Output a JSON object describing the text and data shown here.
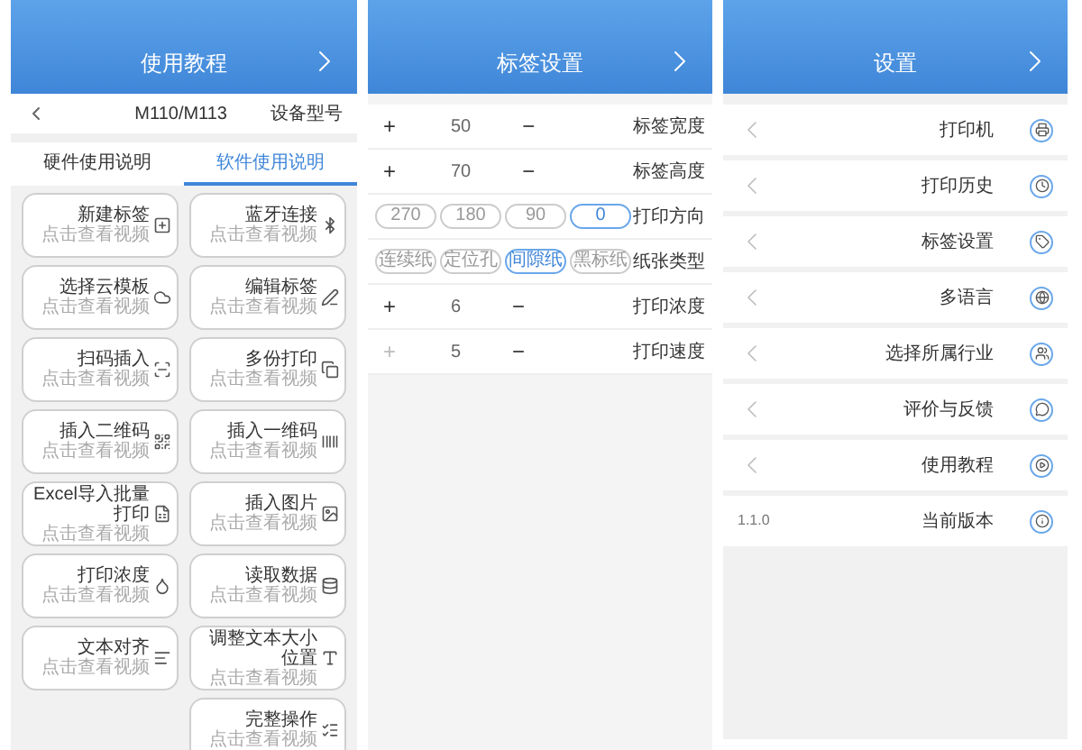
{
  "tutorial": {
    "title": "使用教程",
    "device_label": "设备型号",
    "device_value": "M110/M113",
    "tabs": [
      {
        "label": "硬件使用说明",
        "selected": false
      },
      {
        "label": "软件使用说明",
        "selected": true
      }
    ],
    "cards": [
      {
        "title": "新建标签",
        "subtitle": "点击查看视频"
      },
      {
        "title": "蓝牙连接",
        "subtitle": "点击查看视频"
      },
      {
        "title": "选择云模板",
        "subtitle": "点击查看视频"
      },
      {
        "title": "编辑标签",
        "subtitle": "点击查看视频"
      },
      {
        "title": "扫码插入",
        "subtitle": "点击查看视频"
      },
      {
        "title": "多份打印",
        "subtitle": "点击查看视频"
      },
      {
        "title": "插入二维码",
        "subtitle": "点击查看视频"
      },
      {
        "title": "插入一维码",
        "subtitle": "点击查看视频"
      },
      {
        "title": "Excel导入批量打印",
        "subtitle": "点击查看视频"
      },
      {
        "title": "插入图片",
        "subtitle": "点击查看视频"
      },
      {
        "title": "打印浓度",
        "subtitle": "点击查看视频"
      },
      {
        "title": "读取数据",
        "subtitle": "点击查看视频"
      },
      {
        "title": "文本对齐",
        "subtitle": "点击查看视频"
      },
      {
        "title": "调整文本大小位置",
        "subtitle": "点击查看视频"
      },
      {
        "title": "完整操作",
        "subtitle": "点击查看视频"
      }
    ]
  },
  "label_settings": {
    "title": "标签设置",
    "rows": [
      {
        "kind": "stepper",
        "label": "标签宽度",
        "plus": "+",
        "minus": "−",
        "value": "50",
        "plus_disabled": false
      },
      {
        "kind": "stepper",
        "label": "标签高度",
        "plus": "+",
        "minus": "−",
        "value": "70",
        "plus_disabled": false
      },
      {
        "kind": "options",
        "label": "打印方向",
        "options": [
          {
            "label": "270",
            "selected": false
          },
          {
            "label": "180",
            "selected": false
          },
          {
            "label": "90",
            "selected": false
          },
          {
            "label": "0",
            "selected": true
          }
        ]
      },
      {
        "kind": "options",
        "label": "纸张类型",
        "options": [
          {
            "label": "连续纸",
            "selected": false
          },
          {
            "label": "定位孔",
            "selected": false
          },
          {
            "label": "间隙纸",
            "selected": true
          },
          {
            "label": "黑标纸",
            "selected": false
          }
        ]
      },
      {
        "kind": "stepper",
        "label": "打印浓度",
        "plus": "+",
        "minus": "−",
        "value": "6",
        "plus_disabled": false
      },
      {
        "kind": "stepper",
        "label": "打印速度",
        "plus": "+",
        "minus": "−",
        "value": "5",
        "plus_disabled": true
      }
    ]
  },
  "settings": {
    "title": "设置",
    "items": [
      {
        "kind": "link",
        "label": "打印机"
      },
      {
        "kind": "link",
        "label": "打印历史"
      },
      {
        "kind": "link",
        "label": "标签设置"
      },
      {
        "kind": "link",
        "label": "多语言"
      },
      {
        "kind": "link",
        "label": "选择所属行业"
      },
      {
        "kind": "link",
        "label": "评价与反馈"
      },
      {
        "kind": "link",
        "label": "使用教程"
      },
      {
        "kind": "value",
        "label": "当前版本",
        "value": "1.1.0"
      }
    ]
  }
}
